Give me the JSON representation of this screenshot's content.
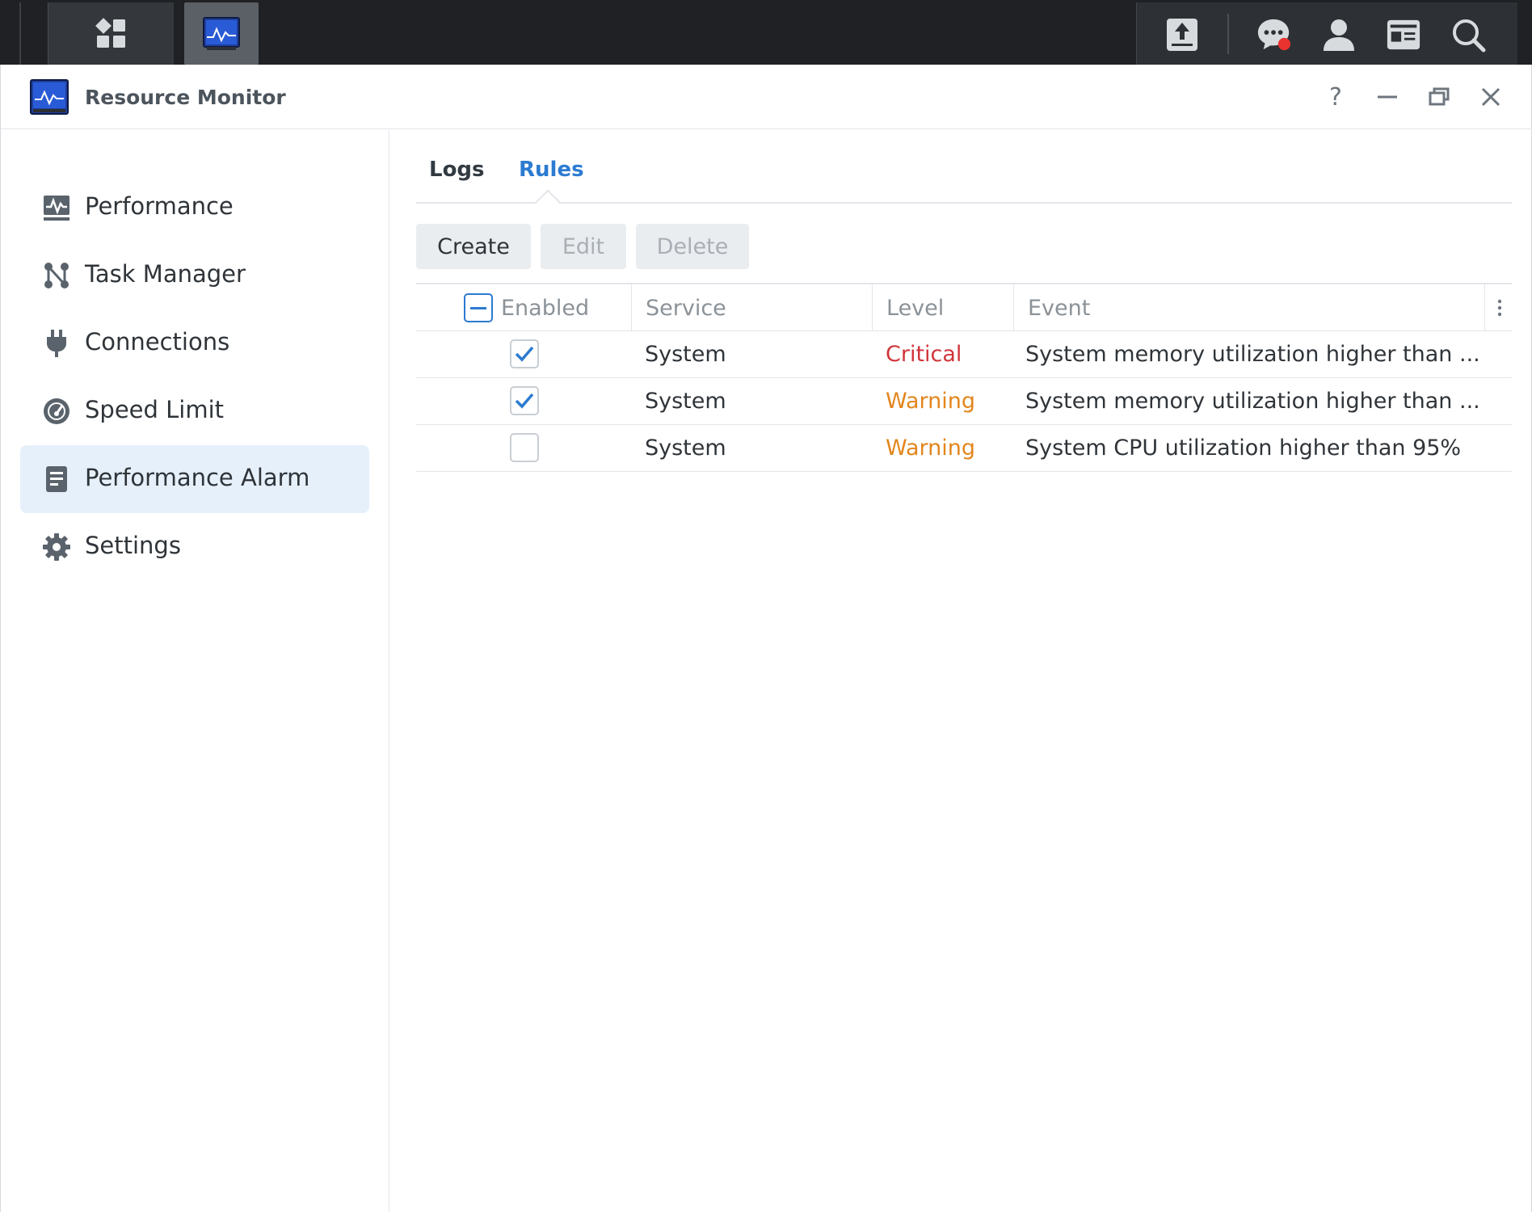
{
  "taskbar": {
    "icons": [
      "main-menu-icon",
      "resource-monitor-icon",
      "upload-icon",
      "chat-icon",
      "user-icon",
      "widgets-icon",
      "search-icon"
    ],
    "notification_color": "#e8332f"
  },
  "window": {
    "title": "Resource Monitor",
    "controls": [
      "help-icon",
      "minimize-icon",
      "restore-icon",
      "close-icon"
    ],
    "help_label": "?"
  },
  "sidebar": {
    "items": [
      {
        "label": "Performance",
        "icon": "performance-icon"
      },
      {
        "label": "Task Manager",
        "icon": "task-manager-icon"
      },
      {
        "label": "Connections",
        "icon": "plug-icon"
      },
      {
        "label": "Speed Limit",
        "icon": "gauge-icon"
      },
      {
        "label": "Performance Alarm",
        "icon": "alarm-list-icon",
        "active": true
      },
      {
        "label": "Settings",
        "icon": "gear-icon"
      }
    ]
  },
  "tabs": [
    {
      "label": "Logs",
      "active": false
    },
    {
      "label": "Rules",
      "active": true
    }
  ],
  "toolbar": {
    "create_label": "Create",
    "edit_label": "Edit",
    "delete_label": "Delete"
  },
  "table": {
    "columns": [
      "Enabled",
      "Service",
      "Level",
      "Event"
    ],
    "rows": [
      {
        "enabled": true,
        "service": "System",
        "level": "Critical",
        "event": "System memory utilization higher than ..."
      },
      {
        "enabled": true,
        "service": "System",
        "level": "Warning",
        "event": "System memory utilization higher than ..."
      },
      {
        "enabled": false,
        "service": "System",
        "level": "Warning",
        "event": "System CPU utilization higher than 95%"
      }
    ]
  },
  "colors": {
    "accent": "#2c7bd1",
    "critical": "#d0353a",
    "warning": "#e3861d",
    "active_nav_bg": "#e6f0fb"
  }
}
